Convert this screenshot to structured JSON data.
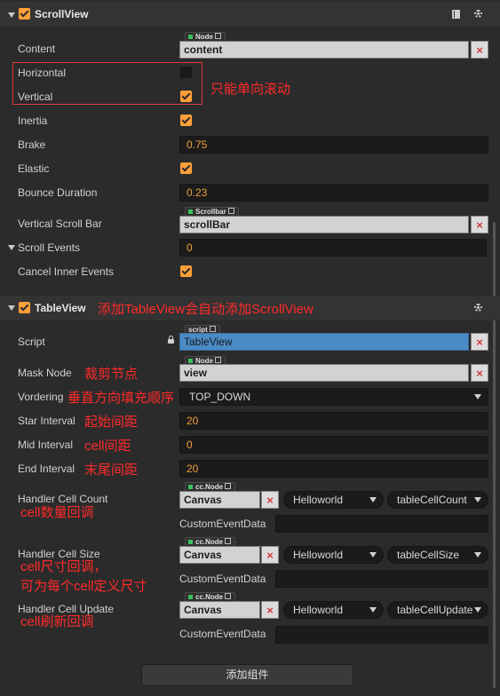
{
  "scrollview": {
    "title": "ScrollView",
    "content": {
      "label": "Content",
      "tag": "Node",
      "value": "content"
    },
    "horizontal": {
      "label": "Horizontal",
      "checked": false
    },
    "vertical": {
      "label": "Vertical",
      "checked": true
    },
    "inertia": {
      "label": "Inertia",
      "checked": true
    },
    "brake": {
      "label": "Brake",
      "value": "0.75"
    },
    "elastic": {
      "label": "Elastic",
      "checked": true
    },
    "bounce": {
      "label": "Bounce Duration",
      "value": "0.23"
    },
    "scrollbar": {
      "label": "Vertical Scroll Bar",
      "tag": "Scrollbar",
      "value": "scrollBar"
    },
    "events": {
      "label": "Scroll Events",
      "value": "0"
    },
    "cancel": {
      "label": "Cancel Inner Events",
      "checked": true
    },
    "remove_symbol": "×"
  },
  "tableview": {
    "title": "TableView",
    "script": {
      "label": "Script",
      "tag": "script",
      "value": "TableView"
    },
    "mask": {
      "label": "Mask Node",
      "tag": "Node",
      "value": "view"
    },
    "vordering": {
      "label": "Vordering",
      "value": "TOP_DOWN"
    },
    "star": {
      "label": "Star Interval",
      "value": "20"
    },
    "mid": {
      "label": "Mid Interval",
      "value": "0"
    },
    "end": {
      "label": "End Interval",
      "value": "20"
    },
    "handler_count": {
      "label": "Handler Cell Count",
      "tag": "cc.Node",
      "node": "Canvas",
      "component": "Helloworld",
      "method": "tableCellCount",
      "data_label": "CustomEventData"
    },
    "handler_size": {
      "label": "Handler Cell Size",
      "tag": "cc.Node",
      "node": "Canvas",
      "component": "Helloworld",
      "method": "tableCellSize",
      "data_label": "CustomEventData"
    },
    "handler_update": {
      "label": "Handler Cell Update",
      "tag": "cc.Node",
      "node": "Canvas",
      "component": "Helloworld",
      "method": "tableCellUpdate",
      "data_label": "CustomEventData"
    }
  },
  "add_component": "添加组件",
  "annotations": {
    "single_direction": "只能单向滚动",
    "auto_add": "添加TableView会自动添加ScrollView",
    "mask": "裁剪节点",
    "vordering": "垂直方向填充顺序",
    "star": "起始间距",
    "mid": "cell间距",
    "end": "末尾间距",
    "count": "cell数量回调",
    "size_line1": "cell尺寸回调，",
    "size_line2": "可为每个cell定义尺寸",
    "update": "cell刷新回调"
  },
  "colors": {
    "accent": "#ff9f3a",
    "annotation": "#ff2a2a",
    "selected": "#4a8bc6"
  }
}
